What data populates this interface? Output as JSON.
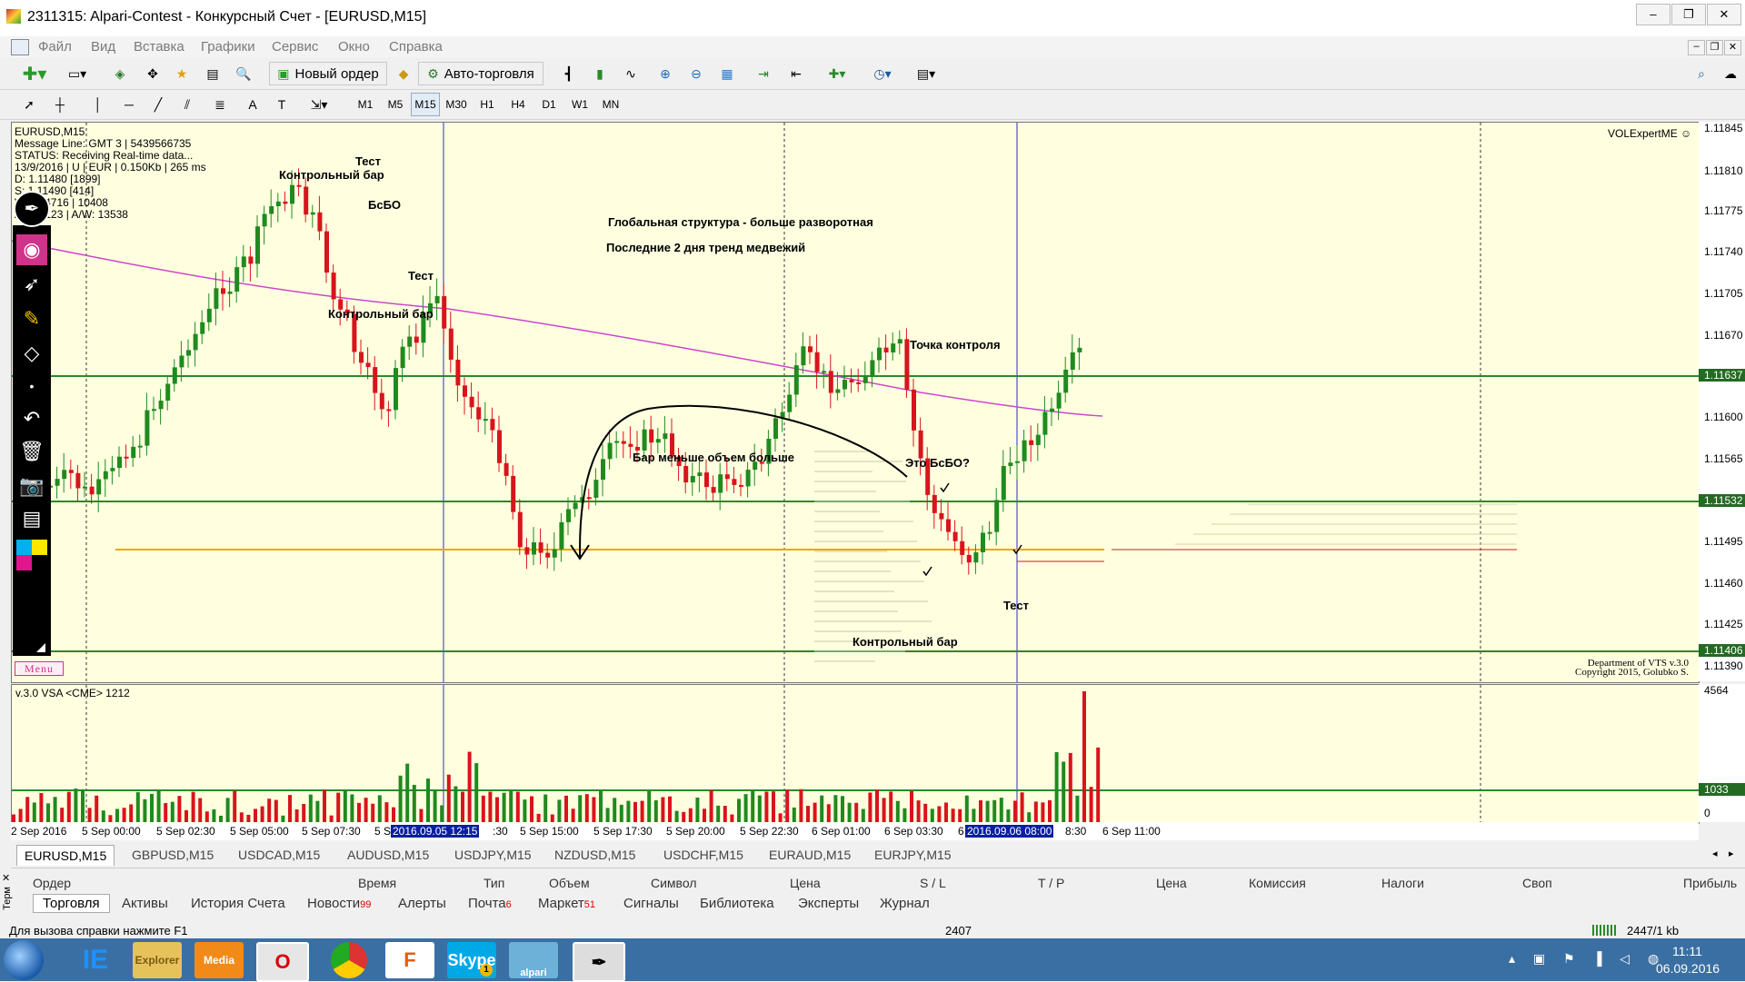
{
  "window": {
    "title": "2311315: Alpari-Contest - Конкурсный Счет - [EURUSD,M15]",
    "controls": [
      "–",
      "❐",
      "✕"
    ]
  },
  "menu": [
    "Файл",
    "Вид",
    "Вставка",
    "Графики",
    "Сервис",
    "Окно",
    "Справка"
  ],
  "toolbar": {
    "new_order": "Новый ордер",
    "autotrading": "Авто-торговля",
    "timeframes": [
      "M1",
      "M5",
      "M15",
      "M30",
      "H1",
      "H4",
      "D1",
      "W1",
      "MN"
    ],
    "selected_timeframe": "M15"
  },
  "chart": {
    "info": [
      "EURUSD,M15",
      "Message Line: GMT 3 | 5439566735",
      "STATUS:  Receiving Real-time data...",
      "13/9/2016 | U | EUR | 0.150Kb | 265 ms",
      "D: 1.11480  [1899]",
      "S: 1.11490  [414]",
      "V|D: 24716  |  10408",
      "A/D: 5123  |  A/W: 13538"
    ],
    "indicator_name": "VOLExpertME ☺",
    "copyright": [
      "Department of VTS  v.3.0",
      "Copyright 2015, Golubko S."
    ],
    "menu_label": "Menu",
    "annotations": {
      "test1": "Тест",
      "control_bar1": "Контрольный бар",
      "bsbo1": "БсБО",
      "test2": "Тест",
      "control_bar2": "Контрольный бар",
      "global_structure": "Глобальная структура - больше разворотная",
      "last_two_days": "Последние 2 дня тренд медвежий",
      "control_point": "Точка контроля",
      "bar_less_volume_more": "Бар меньше объем больше",
      "is_this_bsbo": "Это БсБО?",
      "test3": "Тест",
      "control_bar3": "Контрольный бар"
    }
  },
  "price_axis": {
    "labels": [
      "1.11845",
      "1.11810",
      "1.11775",
      "1.11740",
      "1.11705",
      "1.11670",
      "1.11600",
      "1.11565",
      "1.11495",
      "1.11460",
      "1.11425",
      "1.11390"
    ],
    "tags": [
      "1.11637",
      "1.11532",
      "1.11406"
    ],
    "tag_color": "#236a23"
  },
  "indicator": {
    "title": "v.3.0 VSA <CME> 1212",
    "max_label": "4564",
    "level_tag": "1033",
    "zero_label": "0"
  },
  "time_axis": {
    "labels": [
      "2 Sep 2016",
      "5 Sep 00:00",
      "5 Sep 02:30",
      "5 Sep 05:00",
      "5 Sep 07:30",
      "5 S",
      ":30",
      "5 Sep 15:00",
      "5 Sep 17:30",
      "5 Sep 20:00",
      "5 Sep 22:30",
      "6 Sep 01:00",
      "6 Sep 03:30",
      "6",
      "8:30",
      "6 Sep 11:00"
    ],
    "highlight1": "2016.09.05 12:15",
    "highlight2": "2016.09.06 08:00"
  },
  "symbol_tabs": [
    "EURUSD,M15",
    "GBPUSD,M15",
    "USDCAD,M15",
    "AUDUSD,M15",
    "USDJPY,M15",
    "NZDUSD,M15",
    "USDCHF,M15",
    "EURAUD,M15",
    "EURJPY,M15"
  ],
  "terminal": {
    "columns": [
      "Ордер",
      "Время",
      "Тип",
      "Объем",
      "Символ",
      "Цена",
      "S / L",
      "T / P",
      "Цена",
      "Комиссия",
      "Налоги",
      "Своп",
      "Прибыль"
    ],
    "tabs": [
      "Торговля",
      "Активы",
      "История Счета",
      "Новости",
      "Алерты",
      "Почта",
      "Маркет",
      "Сигналы",
      "Библиотека",
      "Эксперты",
      "Журнал"
    ],
    "badges": {
      "news": "99",
      "mail": "6",
      "market": "51"
    },
    "side_label": "Терм"
  },
  "statusbar": {
    "help": "Для вызова справки нажмите F1",
    "code": "2407",
    "traffic": "2447/1 kb"
  },
  "taskbar": {
    "apps": [
      "IE",
      "Explorer",
      "Media",
      "Opera",
      "Chrome",
      "F",
      "Skype",
      "alpari",
      "MT"
    ],
    "skype_badge": "1",
    "time": "11:11",
    "date": "06.09.2016"
  },
  "colors": {
    "chart_bg": "#ffffe0",
    "bull": "#1f8a1f",
    "bear": "#d8141c",
    "level": "#2a8a2a",
    "ma": "#cc44cc",
    "poc": "#f2a400",
    "period_sep": "#2a2ad8"
  }
}
